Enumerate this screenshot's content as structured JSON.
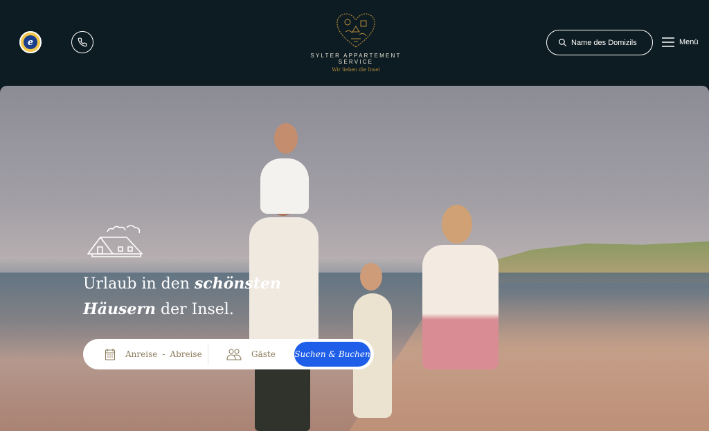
{
  "header": {
    "trust_badge_letter": "e",
    "brand_name": "SYLTER APPARTEMENT SERVICE",
    "brand_tagline": "Wir lieben die Insel",
    "search": {
      "placeholder": "Name des Domizils",
      "value": ""
    },
    "menu_label": "Menü"
  },
  "hero": {
    "headline_part1": "Urlaub in den ",
    "headline_emph1": "schönsten",
    "headline_emph2": "Häusern",
    "headline_part2": " der Insel.",
    "booking": {
      "arrival_label": "Anreise",
      "separator": "-",
      "departure_label": "Abreise",
      "guests_label": "Gäste",
      "submit_label": "Suchen & Buchen"
    }
  },
  "colors": {
    "header_bg": "#0d1c22",
    "accent_blue": "#1f5ee8",
    "gold": "#b58a3c"
  },
  "icons": [
    "trusted-shops-badge",
    "phone-icon",
    "heart-logo-icon",
    "search-icon",
    "hamburger-icon",
    "house-icon",
    "calendar-icon",
    "guests-icon"
  ]
}
